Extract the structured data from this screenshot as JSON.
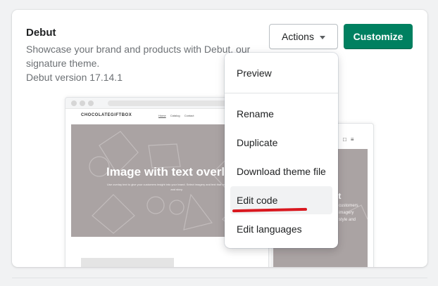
{
  "theme": {
    "title": "Debut",
    "description": "Showcase your brand and products with Debut, our signature theme.",
    "version": "Debut version 17.14.1"
  },
  "buttons": {
    "actions_label": "Actions",
    "customize_label": "Customize"
  },
  "preview": {
    "store_logo": "CHOCOLATEGIFTBOX",
    "nav": [
      "Home",
      "Catalog",
      "Contact"
    ],
    "hero_title": "Image with text overla",
    "hero_subtitle": "Use overlay text to give your customers insight into your brand. Select imagery and text that relates to your style and story.",
    "mobile_title": "text",
    "mobile_subtitle": "customers imagery style and"
  },
  "dropdown": {
    "items": [
      {
        "label": "Preview"
      },
      {
        "label": "Rename"
      },
      {
        "label": "Duplicate"
      },
      {
        "label": "Download theme file"
      },
      {
        "label": "Edit code"
      },
      {
        "label": "Edit languages"
      }
    ],
    "highlighted": "Edit code"
  },
  "colors": {
    "primary": "#008060",
    "annotation_underline": "#d9181f",
    "hero_bg": "#aaa3a3"
  },
  "icons": {
    "actions_caret": "caret-down-icon",
    "mobile_icons": [
      "bag-icon",
      "menu-icon"
    ]
  }
}
